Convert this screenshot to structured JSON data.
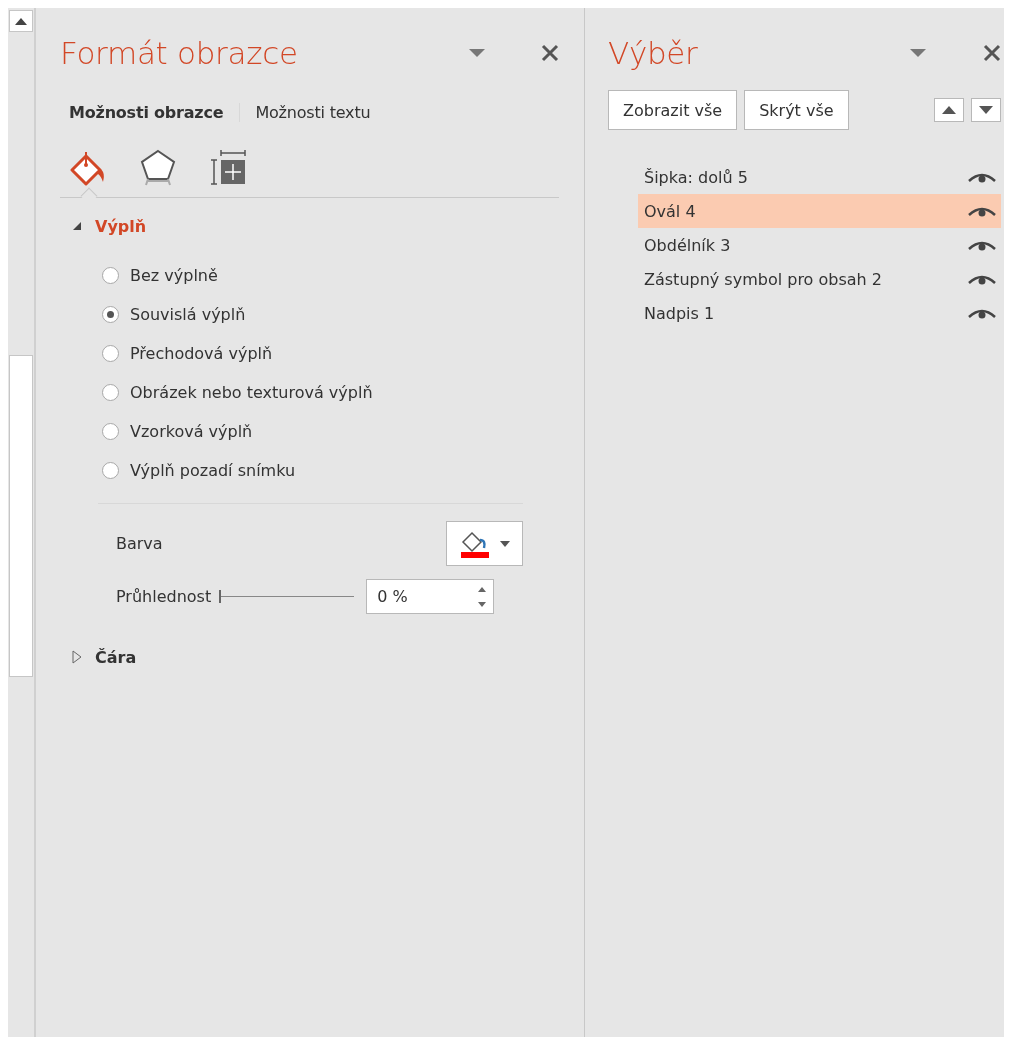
{
  "format_pane": {
    "title": "Formát obrazce",
    "tabs": [
      {
        "label": "Možnosti obrazce",
        "selected": true
      },
      {
        "label": "Možnosti textu",
        "selected": false
      }
    ],
    "categories": [
      {
        "kind": "fill",
        "selected": true
      },
      {
        "kind": "effects",
        "selected": false
      },
      {
        "kind": "size",
        "selected": false
      }
    ],
    "sections": [
      {
        "title": "Výplň",
        "expanded": true,
        "options": [
          {
            "label": "Bez výplně",
            "selected": false
          },
          {
            "label": "Souvislá výplň",
            "selected": true
          },
          {
            "label": "Přechodová výplň",
            "selected": false
          },
          {
            "label": "Obrázek nebo texturová výplň",
            "selected": false
          },
          {
            "label": "Vzorková výplň",
            "selected": false
          },
          {
            "label": "Výplň pozadí snímku",
            "selected": false
          }
        ],
        "fill_color": {
          "label": "Barva",
          "color": "#ff0000"
        },
        "transparency": {
          "label": "Průhlednost",
          "level": 0,
          "value": "0 %"
        }
      },
      {
        "title": "Čára",
        "expanded": false
      }
    ]
  },
  "selection_pane": {
    "title": "Výběr",
    "buttons": [
      "Zobrazit vše",
      "Skrýt vše"
    ],
    "items": [
      {
        "label": "Šipka: dolů 5",
        "selected": false,
        "visible": true
      },
      {
        "label": "Ovál 4",
        "selected": true,
        "visible": true
      },
      {
        "label": "Obdélník 3",
        "selected": false,
        "visible": true
      },
      {
        "label": "Zástupný symbol pro obsah 2",
        "selected": false,
        "visible": true
      },
      {
        "label": "Nadpis 1",
        "selected": false,
        "visible": true
      }
    ]
  }
}
